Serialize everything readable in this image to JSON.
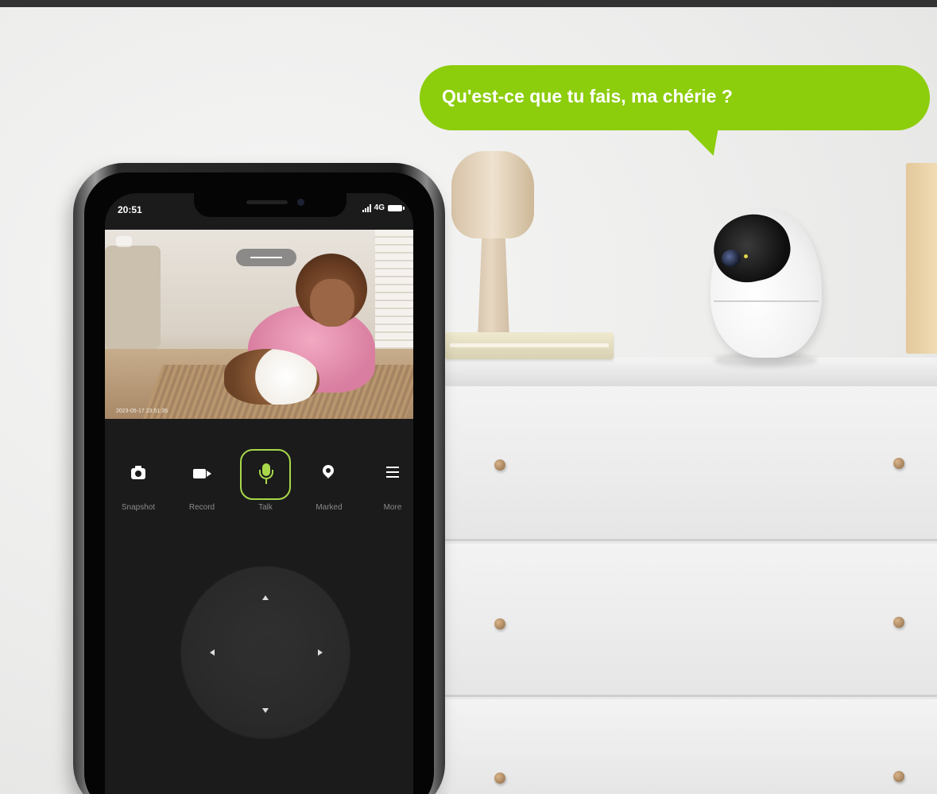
{
  "bubble": {
    "text": "Qu'est-ce que tu fais, ma chérie ?",
    "color": "#8ccd0c"
  },
  "phone": {
    "status": {
      "time": "20:51",
      "network": "4G"
    },
    "feed": {
      "timestamp": "2023-05-17 23:51:35"
    },
    "controls": [
      {
        "label": "Snapshot",
        "icon": "camera-icon",
        "active": false
      },
      {
        "label": "Record",
        "icon": "video-icon",
        "active": false
      },
      {
        "label": "Talk",
        "icon": "mic-icon",
        "active": true
      },
      {
        "label": "Marked",
        "icon": "pin-icon",
        "active": false
      },
      {
        "label": "More",
        "icon": "menu-icon",
        "active": false
      }
    ],
    "accent_color": "#a8d84a"
  }
}
